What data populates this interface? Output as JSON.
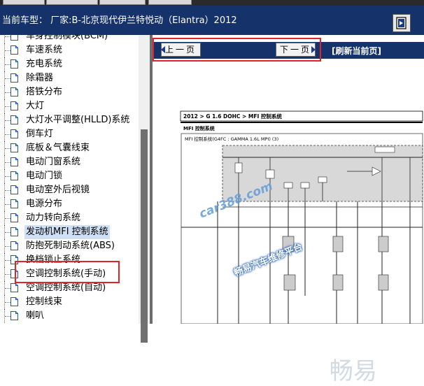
{
  "header": {
    "title": "当前车型：  厂家:B-北京现代伊兰特悦动（Elantra）2012",
    "nav_icon": "exit-door-icon"
  },
  "sidebar": {
    "items": [
      {
        "label": "车身控制模块(BCM)"
      },
      {
        "label": "车速系统"
      },
      {
        "label": "充电系统"
      },
      {
        "label": "除霜器"
      },
      {
        "label": "搭铁分布"
      },
      {
        "label": "大灯"
      },
      {
        "label": "大灯水平调整(HLLD)系统"
      },
      {
        "label": "倒车灯"
      },
      {
        "label": "底板＆气囊线束"
      },
      {
        "label": "电动门窗系统"
      },
      {
        "label": "电动门锁"
      },
      {
        "label": "电动室外后视镜"
      },
      {
        "label": "电源分布"
      },
      {
        "label": "动力转向系统"
      },
      {
        "label": "发动机MFI 控制系统",
        "selected": true
      },
      {
        "label": "防抱死制动系统(ABS)"
      },
      {
        "label": "换档锁止系统"
      },
      {
        "label": "空调控制系统(手动)"
      },
      {
        "label": "空调控制系统(自动)"
      },
      {
        "label": "控制线束"
      },
      {
        "label": "喇叭"
      }
    ]
  },
  "toolbar": {
    "prev_label": "上一页",
    "next_label": "下一页",
    "refresh_label": "[刷新当前页]"
  },
  "diagram": {
    "heading": "2012 > G 1.6 DOHC > MFI 控制系统",
    "subheading": "MFI 控制系统",
    "box_title": "MFI 控制系统(G4FC : GAMMA 1.6L MPI)   (3)",
    "watermark_site": "car388.com",
    "watermark_brand": "畅易汽车维修平台",
    "watermark_big": "畅易"
  },
  "colors": {
    "header_bg": "#16326b",
    "highlight_red": "#e0242c",
    "selection_bg": "#cfe0f5"
  }
}
